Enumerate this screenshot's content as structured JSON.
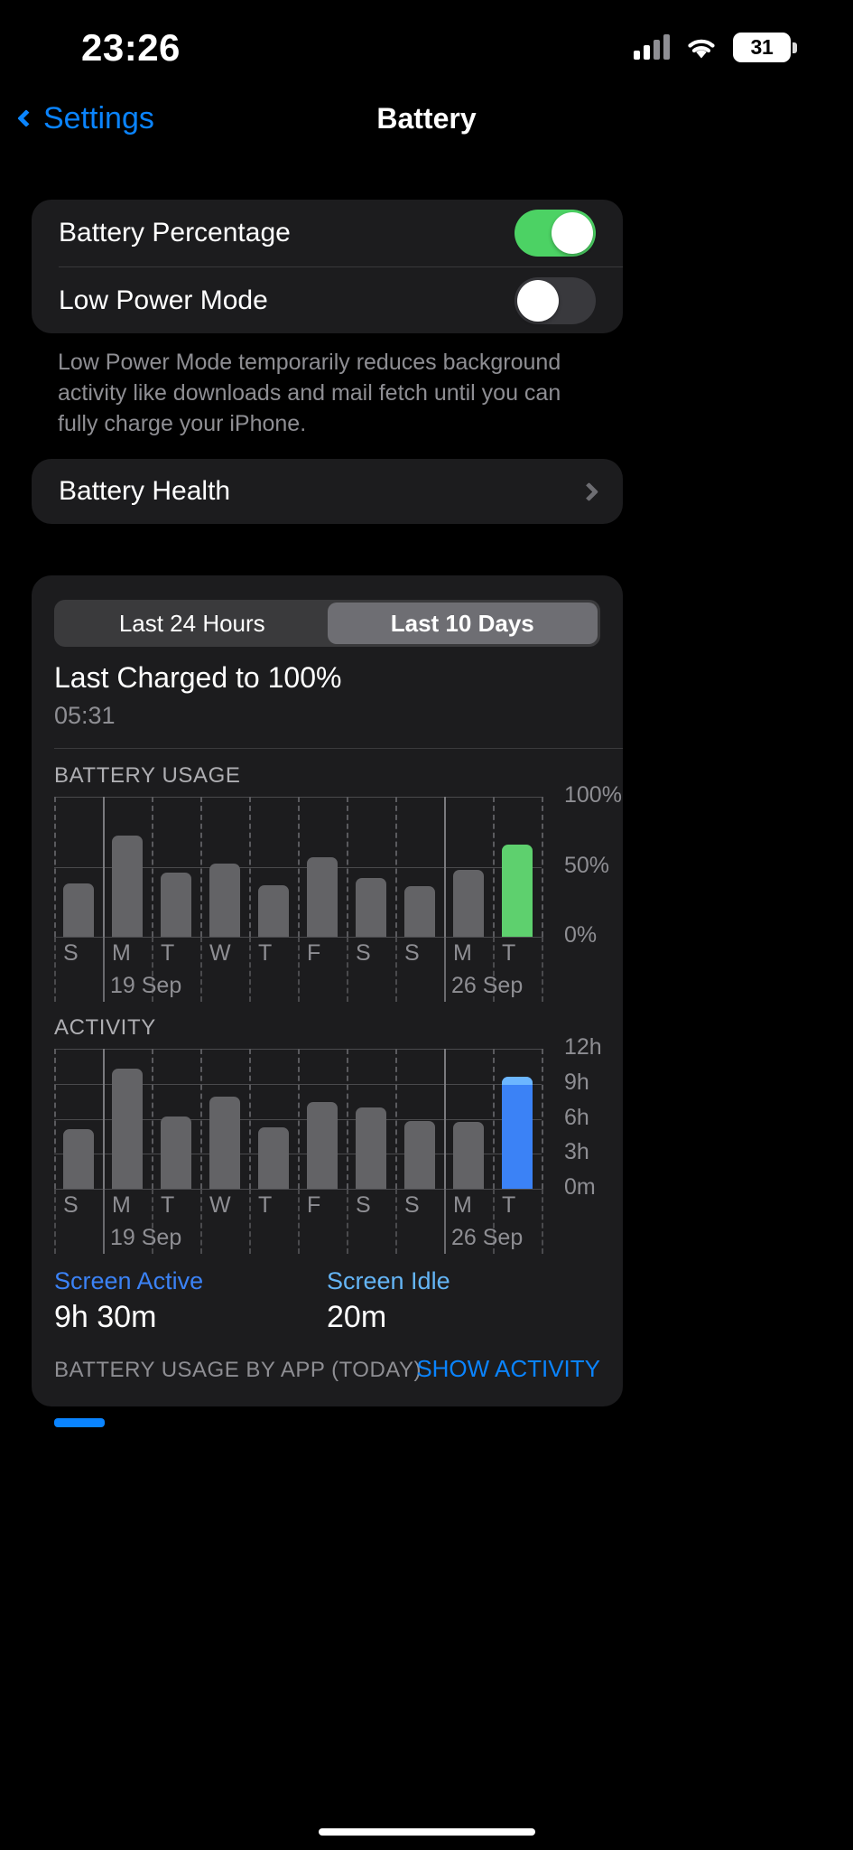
{
  "status_bar": {
    "time": "23:26",
    "battery_percent": "31",
    "cellular_icon": "cellular-bars-icon",
    "wifi_icon": "wifi-icon"
  },
  "nav": {
    "back_label": "Settings",
    "title": "Battery"
  },
  "settings": {
    "battery_percentage_label": "Battery Percentage",
    "battery_percentage_state": "on",
    "low_power_mode_label": "Low Power Mode",
    "low_power_mode_state": "off",
    "footnote": "Low Power Mode temporarily reduces background activity like downloads and mail fetch until you can fully charge your iPhone.",
    "battery_health_label": "Battery Health"
  },
  "usage": {
    "segments": [
      "Last 24 Hours",
      "Last 10 Days"
    ],
    "selected_segment": "Last 10 Days",
    "last_charged_title": "Last Charged to 100%",
    "last_charged_time": "05:31",
    "battery_usage_heading": "BATTERY USAGE",
    "activity_heading": "ACTIVITY",
    "screen_active_label": "Screen Active",
    "screen_active_value": "9h 30m",
    "screen_idle_label": "Screen Idle",
    "screen_idle_value": "20m",
    "by_app_heading": "BATTERY USAGE BY APP (TODAY)",
    "show_activity_label": "SHOW ACTIVITY"
  },
  "colors": {
    "accent_blue": "#0a84ff",
    "toggle_on_green": "#4cd264",
    "bar_green": "#5ed06e",
    "bar_blue": "#3b82f6",
    "idle_blue": "#6cb6ff",
    "bar_gray": "#636366"
  },
  "chart_data": [
    {
      "type": "bar",
      "title": "BATTERY USAGE",
      "categories": [
        "S",
        "M",
        "T",
        "W",
        "T",
        "F",
        "S",
        "S",
        "M",
        "T"
      ],
      "values": [
        38,
        72,
        46,
        52,
        37,
        57,
        42,
        36,
        48,
        66
      ],
      "highlight_index": 9,
      "highlight_color": "#5ed06e",
      "bar_color": "#636366",
      "ylabel": "",
      "xlabel": "",
      "ylim": [
        0,
        100
      ],
      "yticks": [
        0,
        50,
        100
      ],
      "ytick_labels": [
        "0%",
        "50%",
        "100%"
      ],
      "date_labels": [
        {
          "index": 1,
          "text": "19 Sep"
        },
        {
          "index": 8,
          "text": "26 Sep"
        }
      ],
      "grid": true,
      "legend": "none"
    },
    {
      "type": "bar",
      "title": "ACTIVITY",
      "categories": [
        "S",
        "M",
        "T",
        "W",
        "T",
        "F",
        "S",
        "S",
        "M",
        "T"
      ],
      "values": [
        5.1,
        10.3,
        6.2,
        7.9,
        5.3,
        7.4,
        7.0,
        5.8,
        5.7,
        9.6
      ],
      "highlight_index": 9,
      "highlight_color": "#3b82f6",
      "bar_color": "#636366",
      "ylabel": "",
      "xlabel": "",
      "ylim": [
        0,
        12
      ],
      "yticks": [
        0,
        3,
        6,
        9,
        12
      ],
      "ytick_labels": [
        "0m",
        "3h",
        "6h",
        "9h",
        "12h"
      ],
      "date_labels": [
        {
          "index": 1,
          "text": "19 Sep"
        },
        {
          "index": 8,
          "text": "26 Sep"
        }
      ],
      "grid": true,
      "legend": "none"
    }
  ]
}
